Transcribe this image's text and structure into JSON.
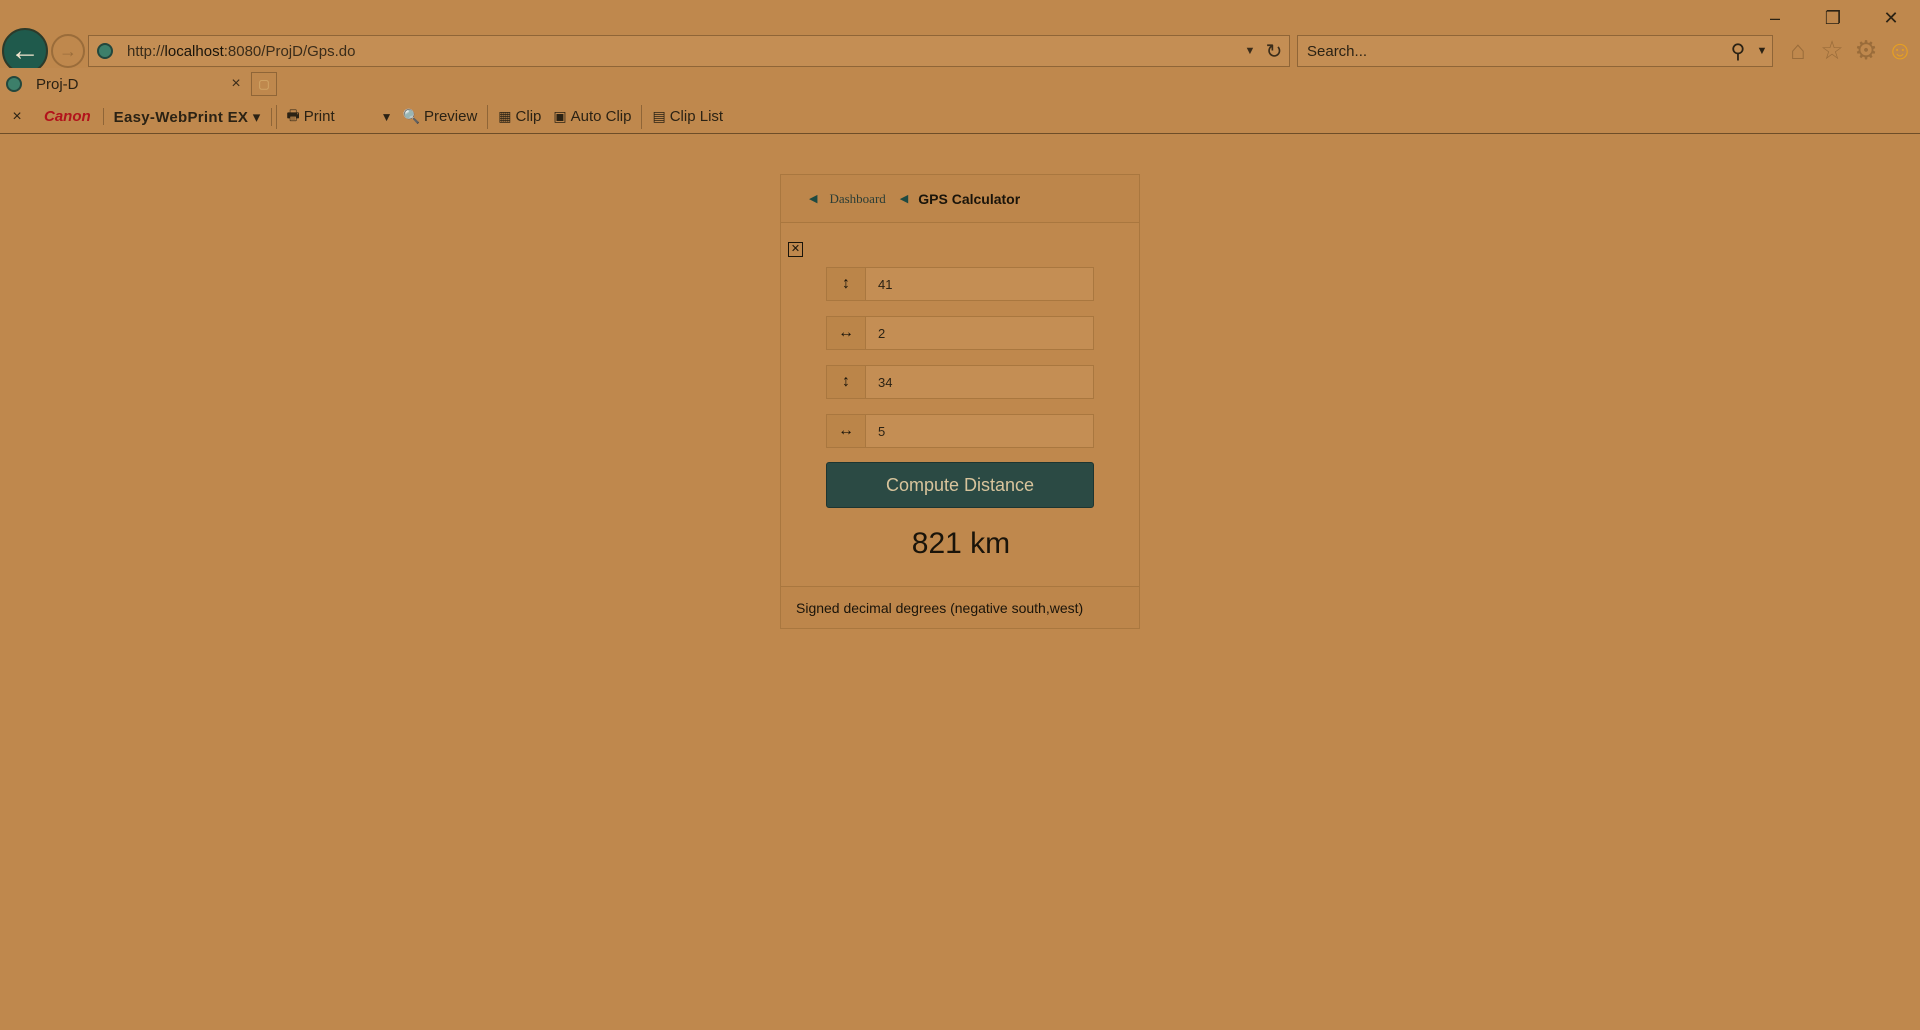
{
  "browser": {
    "back_icon": "←",
    "forward_icon": "→",
    "url_prefix": "http://",
    "url_host": "localhost",
    "url_rest": ":8080/ProjD/Gps.do",
    "search_placeholder": "Search...",
    "icons": [
      "home-icon",
      "favorites-star-icon",
      "settings-gear-icon",
      "feedback-smiley-icon"
    ]
  },
  "tab": {
    "title": "Proj-D",
    "close": "×"
  },
  "command_bar": {
    "close": "×",
    "brand": "Canon",
    "product": "Easy-WebPrint EX",
    "print": "Print",
    "preview": "Preview",
    "clip": "Clip",
    "auto_clip": "Auto Clip",
    "clip_list": "Clip List"
  },
  "card": {
    "breadcrumb": "Dashboard",
    "title": "GPS Calculator",
    "close_box": "✕",
    "fields": [
      {
        "icon": "latitude-arrow-icon",
        "glyph": "↕",
        "value": "41"
      },
      {
        "icon": "longitude-arrow-icon",
        "glyph": "↔",
        "value": "2"
      },
      {
        "icon": "latitude-arrow-icon",
        "glyph": "↕",
        "value": "34"
      },
      {
        "icon": "longitude-arrow-icon",
        "glyph": "↔",
        "value": "5"
      }
    ],
    "button_label": "Compute Distance",
    "result": "821 km",
    "footer": "Signed decimal degrees (negative south,west)"
  },
  "colors": {
    "page_background": "#bf884d",
    "button_background": "#2b4a44",
    "canon_brand": "#b2131b"
  }
}
